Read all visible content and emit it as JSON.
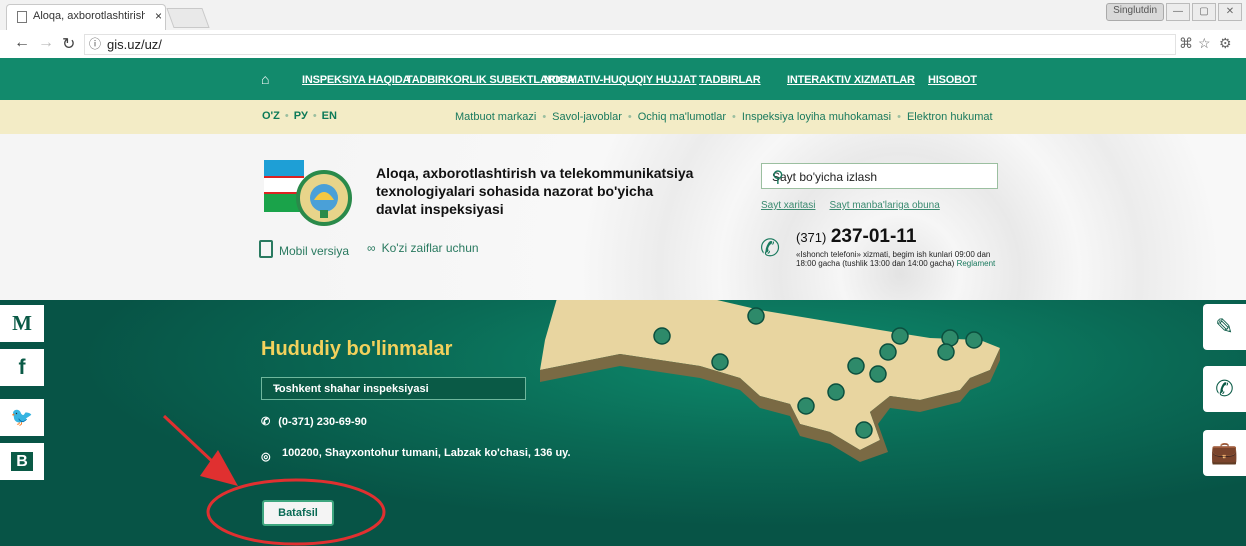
{
  "browser": {
    "tab_title": "Aloqa, axborotlashtirish",
    "tab_close": "×",
    "url": "gis.uz/uz/",
    "user": "Singlutdin",
    "win_buttons": [
      "—",
      "▢",
      "✕"
    ]
  },
  "nav": {
    "items": [
      "INSPEKSIYA HAQIDA",
      "TADBIRKORLIK SUBEKTLARIGA",
      "NORMATIV-HUQUQIY HUJJAT",
      "TADBIRLAR",
      "INTERAKTIV XIZMATLAR",
      "HISOBOT"
    ]
  },
  "lang": {
    "uz": "O'Z",
    "ru": "РУ",
    "en": "EN"
  },
  "quicklinks": [
    "Matbuot markazi",
    "Savol-javoblar",
    "Ochiq ma'lumotlar",
    "Inspeksiya loyiha muhokamasi",
    "Elektron hukumat"
  ],
  "org": {
    "name": "Aloqa, axborotlashtirish va telekommunikatsiya texnologiyalari sohasida nazorat bo'yicha davlat inspeksiyasi"
  },
  "mobile_label": "Mobil versiya",
  "eyes_label": "Ko'zi zaiflar uchun",
  "search": {
    "placeholder": "Sayt bo'yicha izlash",
    "link1": "Sayt xaritasi",
    "link2": "Sayt manba'lariga obuna"
  },
  "hotline": {
    "code": "(371)",
    "number": "237-01-11",
    "desc": "«Ishonch telefoni» xizmati, begim ish kunlari 09:00 dan 18:00 gacha (tushlik 13:00 dan 14:00 gacha)",
    "link": "Reglament"
  },
  "regions": {
    "title": "Hududiy bo'linmalar",
    "selected": "Toshkent shahar inspeksiyasi",
    "phone": "(0-371) 230-69-90",
    "address": "100200, Shayxontohur tumani, Labzak ko'chasi, 136 uy.",
    "button": "Batafsil"
  },
  "social": [
    "M",
    "f",
    "🐦",
    "B"
  ],
  "side_right": [
    "✎",
    "✆",
    "💼"
  ],
  "colors": {
    "nav_green": "#128a6c",
    "light_band": "#f3ecc6",
    "gold": "#f2d15c",
    "annotation_red": "#e03030"
  }
}
